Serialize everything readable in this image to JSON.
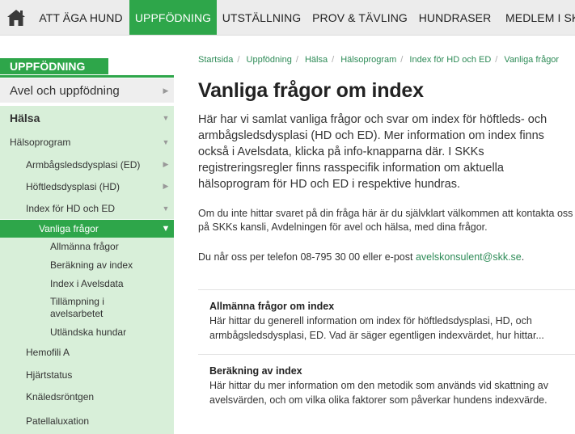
{
  "nav": {
    "home_icon": "house-icon",
    "items": [
      {
        "label": "ATT ÄGA HUND"
      },
      {
        "label": "UPPFÖDNING"
      },
      {
        "label": "UTSTÄLLNING"
      },
      {
        "label": "PROV & TÄVLING"
      },
      {
        "label": "HUNDRASER"
      },
      {
        "label": "MEDLEM I SKK"
      }
    ],
    "active_color": "#2ea64a"
  },
  "sidebar": {
    "heading": "UPPFÖDNING",
    "items": [
      {
        "label": "Avel och uppfödning"
      },
      {
        "label": "Hälsa"
      },
      {
        "label": "Hälsoprogram"
      },
      {
        "label": "Armbågsledsdysplasi (ED)"
      },
      {
        "label": "Höftledsdysplasi (HD)"
      },
      {
        "label": "Index för HD och ED"
      },
      {
        "label": "Vanliga frågor"
      },
      {
        "label": "Allmänna frågor"
      },
      {
        "label": "Beräkning av index"
      },
      {
        "label": "Index i Avelsdata"
      },
      {
        "label": "Tillämpning i avelsarbetet"
      },
      {
        "label": "Utländska hundar"
      },
      {
        "label": "Hemofili A"
      },
      {
        "label": "Hjärtstatus"
      },
      {
        "label": "Knäledsröntgen"
      },
      {
        "label": "Patellaluxation"
      }
    ]
  },
  "breadcrumb": [
    "Startsida",
    "Uppfödning",
    "Hälsa",
    "Hälsoprogram",
    "Index för HD och ED",
    "Vanliga frågor"
  ],
  "page": {
    "title": "Vanliga frågor om index",
    "lead": "Här har vi samlat vanliga frågor och svar om index för höftleds- och armbågsledsdysplasi (HD och ED). Mer information om index finns också i Avelsdata, klicka på info-knapparna där. I SKKs registreringsregler finns rasspecifik information om aktuella hälsoprogram för HD och ED i respektive hundras.",
    "contact": "Om du inte hittar svaret på din fråga här är du självklart välkommen att kontakta oss på SKKs kansli, Avdelningen för avel och hälsa, med dina frågor.",
    "phone_text": "Du når oss per telefon 08-795 30 00 eller e-post",
    "email": "avelskonsulent@skk.se",
    "phone_end": "."
  },
  "cards": [
    {
      "title": "Allmänna frågor om index",
      "text": "Här hittar du generell information om index för höftledsdysplasi, HD, och armbågsledsdysplasi, ED. Vad är säger egentligen indexvärdet, hur hittar..."
    },
    {
      "title": "Beräkning av index",
      "text": "Här hittar du mer information om den metodik som används vid skattning av avelsvärden, och om vilka olika faktorer som påverkar hundens indexvärde."
    }
  ]
}
